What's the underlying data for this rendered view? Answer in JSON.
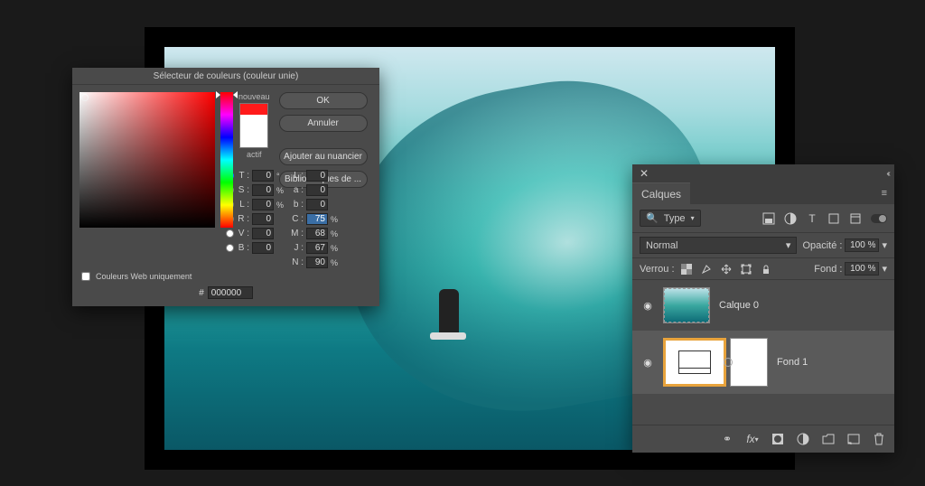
{
  "picker": {
    "title": "Sélecteur de couleurs (couleur unie)",
    "new_label": "nouveau",
    "current_label": "actif",
    "buttons": {
      "ok": "OK",
      "cancel": "Annuler",
      "add_swatch": "Ajouter au nuancier",
      "libraries": "Bibliothèques de ..."
    },
    "web_only_label": "Couleurs Web uniquement",
    "hex_prefix": "#",
    "hex_value": "000000",
    "fields": {
      "T": {
        "label": "T :",
        "value": "0",
        "unit": "°"
      },
      "S": {
        "label": "S :",
        "value": "0",
        "unit": "%"
      },
      "L": {
        "label": "L :",
        "value": "0",
        "unit": "%"
      },
      "R": {
        "label": "R :",
        "value": "0",
        "unit": ""
      },
      "V": {
        "label": "V :",
        "value": "0",
        "unit": ""
      },
      "B": {
        "label": "B :",
        "value": "0",
        "unit": ""
      },
      "Lb": {
        "label": "L :",
        "value": "0",
        "unit": ""
      },
      "a": {
        "label": "a :",
        "value": "0",
        "unit": ""
      },
      "bb": {
        "label": "b :",
        "value": "0",
        "unit": ""
      },
      "C": {
        "label": "C :",
        "value": "75",
        "unit": "%"
      },
      "M": {
        "label": "M :",
        "value": "68",
        "unit": "%"
      },
      "J": {
        "label": "J :",
        "value": "67",
        "unit": "%"
      },
      "N": {
        "label": "N :",
        "value": "90",
        "unit": "%"
      }
    }
  },
  "layers_panel": {
    "tab_title": "Calques",
    "type_filter_label": "Type",
    "blend_mode": "Normal",
    "opacity_label": "Opacité :",
    "opacity_value": "100 %",
    "lock_label": "Verrou :",
    "fill_label": "Fond :",
    "fill_value": "100 %",
    "layers": [
      {
        "name": "Calque 0",
        "visible": true,
        "kind": "pixel"
      },
      {
        "name": "Fond 1",
        "visible": true,
        "kind": "solid-fill",
        "selected": true
      }
    ]
  }
}
